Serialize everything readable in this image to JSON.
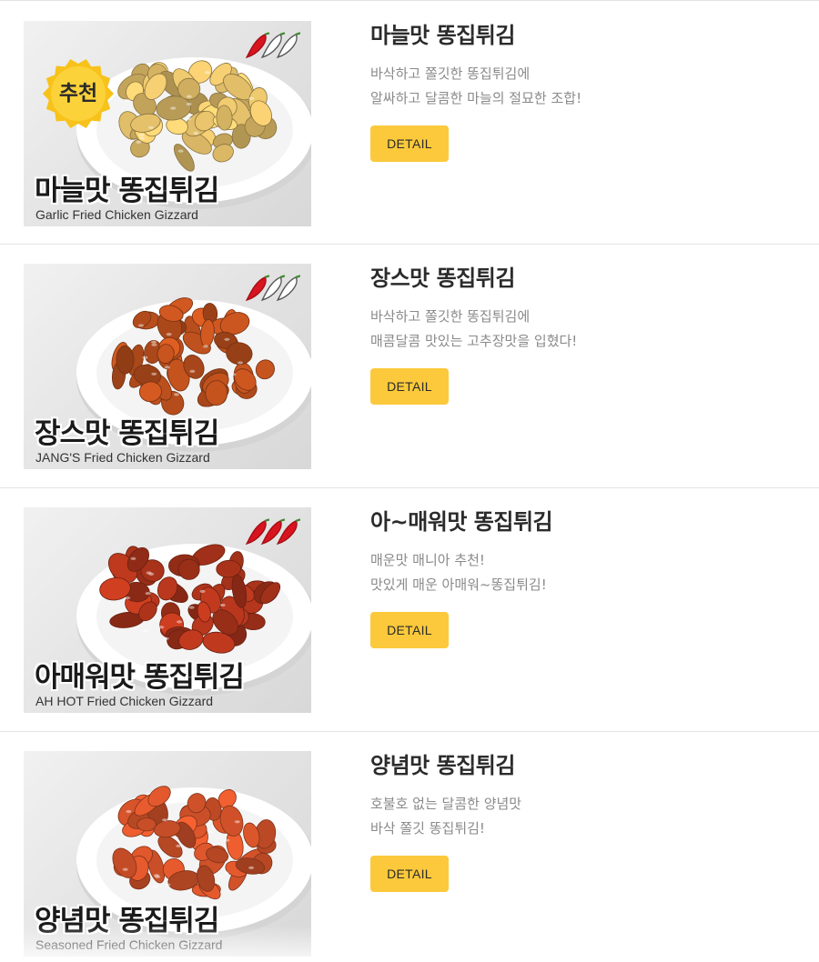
{
  "colors": {
    "button_bg": "#fbc93b",
    "title_text": "#2b2b2b",
    "desc_text": "#8a8a8a",
    "badge_bg": "#f7c21a",
    "pepper_red": "#d8141e"
  },
  "items": [
    {
      "name": "마늘맛 똥집튀김",
      "desc_line1": "바삭하고 쫄깃한 똥집튀김에",
      "desc_line2": "알싸하고 달콤한 마늘의 절묘한 조합!",
      "detail_label": "DETAIL",
      "image_title": "마늘맛 똥집튀김",
      "image_subtitle": "Garlic Fried Chicken Gizzard",
      "badge": "추천",
      "spice_level": 1,
      "food_color": "#e4c06a"
    },
    {
      "name": "장스맛 똥집튀김",
      "desc_line1": "바삭하고 쫄깃한 똥집튀김에",
      "desc_line2": "매콤달콤 맛있는 고추장맛을 입혔다!",
      "detail_label": "DETAIL",
      "image_title": "장스맛 똥집튀김",
      "image_subtitle": "JANG'S Fried Chicken Gizzard",
      "spice_level": 1,
      "food_color": "#c2521e"
    },
    {
      "name": "아~매워맛 똥집튀김",
      "desc_line1": "매운맛 매니아 추천!",
      "desc_line2": "맛있게 매운 아매워~똥집튀김!",
      "detail_label": "DETAIL",
      "image_title": "아매워맛 똥집튀김",
      "image_subtitle": "AH HOT Fried Chicken Gizzard",
      "spice_level": 3,
      "food_color": "#b3361c"
    },
    {
      "name": "양념맛 똥집튀김",
      "desc_line1": "호불호 없는 달콤한 양념맛",
      "desc_line2": "바삭 쫄깃 똥집튀김!",
      "detail_label": "DETAIL",
      "image_title": "양념맛 똥집튀김",
      "image_subtitle": "Seasoned Fried Chicken Gizzard",
      "spice_level": 0,
      "food_color": "#d4532a"
    }
  ]
}
